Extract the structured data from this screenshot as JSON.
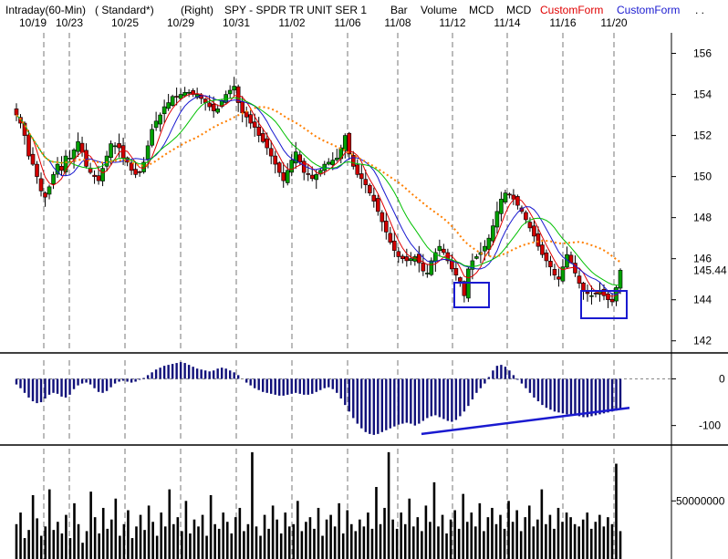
{
  "header": {
    "segments": [
      {
        "text": "Intraday(60-Min)",
        "color": "#000000"
      },
      {
        "text": "( Standard*)",
        "color": "#000000"
      },
      {
        "text": "(Right)",
        "color": "#000000"
      },
      {
        "text": "SPY - SPDR TR UNIT SER 1",
        "color": "#000000"
      },
      {
        "text": "Bar",
        "color": "#000000"
      },
      {
        "text": "Volume",
        "color": "#000000"
      },
      {
        "text": "MCD",
        "color": "#000000"
      },
      {
        "text": "MCD",
        "color": "#000000"
      },
      {
        "text": "CustomForm",
        "color": "#e00000"
      },
      {
        "text": "CustomForm",
        "color": "#1a1ad0"
      },
      {
        "text": ". .",
        "color": "#000000"
      }
    ],
    "dates": [
      "10/19",
      "10/23",
      "10/25",
      "10/29",
      "10/31",
      "11/02",
      "11/06",
      "11/08",
      "11/12",
      "11/14",
      "11/16",
      "11/20"
    ]
  },
  "chart_data": [
    {
      "type": "candlestick",
      "panel": "price",
      "ticker": "SPY - SPDR TR UNIT SER 1",
      "interval": "Intraday(60-Min)",
      "x_dates": [
        "10/19",
        "10/23",
        "10/25",
        "10/29",
        "10/31",
        "11/02",
        "11/06",
        "11/08",
        "11/12",
        "11/14",
        "11/16",
        "11/20"
      ],
      "y_ticks": [
        142,
        144,
        146,
        148,
        150,
        152,
        154,
        156
      ],
      "ylim": [
        141.5,
        157
      ],
      "last_value": "145.44",
      "closes": [
        153.0,
        152.6,
        152.0,
        151.0,
        150.6,
        150.0,
        149.3,
        149.0,
        149.5,
        150.1,
        150.6,
        150.3,
        151.0,
        150.9,
        151.3,
        151.7,
        151.2,
        150.5,
        150.2,
        150.0,
        149.8,
        150.4,
        151.0,
        151.6,
        151.5,
        151.4,
        150.9,
        150.7,
        150.3,
        150.1,
        150.2,
        150.7,
        151.5,
        152.3,
        152.7,
        153.0,
        153.4,
        153.6,
        153.9,
        153.9,
        154.0,
        154.1,
        154.1,
        154.0,
        154.0,
        153.8,
        153.6,
        153.4,
        153.2,
        153.3,
        153.7,
        154.0,
        154.2,
        154.4,
        153.6,
        153.1,
        152.9,
        152.6,
        152.4,
        152.0,
        151.7,
        151.4,
        151.0,
        150.6,
        150.2,
        149.8,
        150.3,
        150.8,
        151.2,
        150.7,
        150.2,
        150.1,
        149.9,
        150.1,
        150.3,
        150.6,
        150.7,
        150.8,
        150.9,
        151.4,
        152.0,
        151.1,
        150.5,
        150.1,
        149.9,
        149.6,
        149.2,
        148.8,
        148.3,
        147.8,
        147.3,
        146.8,
        146.4,
        146.1,
        146.0,
        145.9,
        146.0,
        146.1,
        145.8,
        145.4,
        145.3,
        145.9,
        146.3,
        146.6,
        146.3,
        145.9,
        145.5,
        145.2,
        144.9,
        144.2,
        145.5,
        145.9,
        146.1,
        146.3,
        146.6,
        147.0,
        147.6,
        148.3,
        148.9,
        149.2,
        149.1,
        148.9,
        148.6,
        148.3,
        147.9,
        147.5,
        147.1,
        146.6,
        146.2,
        145.9,
        145.6,
        145.2,
        145.0,
        145.6,
        146.2,
        145.8,
        145.3,
        144.8,
        144.4,
        144.3,
        144.2,
        144.3,
        144.4,
        144.2,
        144.0,
        143.9,
        144.6,
        145.44
      ],
      "moving_averages": [
        {
          "name": "CustomForm",
          "color": "#e00000"
        },
        {
          "name": "CustomForm",
          "color": "#1a1ad0"
        },
        {
          "color": "#00c000"
        },
        {
          "color": "#ff7f00",
          "style": "dotted"
        }
      ],
      "annotations": [
        "blue box around bar near 11/12 low (~144)",
        "blue box around bars near 11/20 low (~144)"
      ]
    },
    {
      "type": "histogram",
      "panel": "MCD",
      "name": "MCD",
      "y_ticks": [
        0,
        -100
      ],
      "ylim": [
        -130,
        40
      ],
      "values": [
        -12,
        -20,
        -30,
        -40,
        -48,
        -52,
        -50,
        -42,
        -34,
        -30,
        -32,
        -38,
        -40,
        -34,
        -22,
        -14,
        -10,
        -8,
        -12,
        -20,
        -28,
        -30,
        -26,
        -18,
        -10,
        -6,
        -4,
        -6,
        -8,
        -6,
        -2,
        2,
        8,
        14,
        20,
        24,
        28,
        30,
        32,
        34,
        36,
        34,
        30,
        26,
        22,
        20,
        18,
        16,
        18,
        22,
        24,
        22,
        18,
        14,
        8,
        0,
        -8,
        -14,
        -20,
        -24,
        -28,
        -30,
        -32,
        -34,
        -36,
        -36,
        -34,
        -32,
        -30,
        -32,
        -34,
        -34,
        -32,
        -28,
        -24,
        -20,
        -18,
        -22,
        -30,
        -42,
        -56,
        -70,
        -84,
        -96,
        -106,
        -114,
        -118,
        -120,
        -118,
        -114,
        -110,
        -106,
        -102,
        -98,
        -96,
        -94,
        -96,
        -100,
        -96,
        -90,
        -84,
        -80,
        -78,
        -82,
        -86,
        -90,
        -92,
        -88,
        -80,
        -70,
        -58,
        -44,
        -30,
        -20,
        -10,
        4,
        18,
        28,
        30,
        26,
        18,
        8,
        -2,
        -10,
        -20,
        -30,
        -40,
        -48,
        -56,
        -62,
        -66,
        -70,
        -72,
        -74,
        -76,
        -78,
        -78,
        -80,
        -82,
        -82,
        -80,
        -78,
        -76,
        -74,
        -72,
        -70,
        -68,
        -66
      ],
      "trendline": {
        "from_value": -118,
        "to_value": -66,
        "color": "#1a1ad0"
      }
    },
    {
      "type": "bar",
      "panel": "Volume",
      "name": "Volume",
      "y_ticks": [
        50000000
      ],
      "y_tick_labels": [
        "50000000"
      ],
      "ylim": [
        0,
        95000000
      ],
      "values": [
        30,
        40,
        18,
        25,
        55,
        35,
        20,
        28,
        60,
        25,
        32,
        22,
        38,
        18,
        48,
        30,
        14,
        24,
        58,
        36,
        22,
        44,
        26,
        34,
        52,
        20,
        30,
        42,
        18,
        28,
        38,
        25,
        46,
        32,
        20,
        40,
        28,
        60,
        30,
        36,
        24,
        50,
        22,
        34,
        28,
        38,
        20,
        55,
        30,
        26,
        40,
        32,
        22,
        36,
        44,
        24,
        30,
        92,
        28,
        20,
        38,
        26,
        46,
        34,
        22,
        40,
        28,
        30,
        50,
        24,
        32,
        36,
        26,
        44,
        20,
        34,
        38,
        28,
        48,
        22,
        42,
        30,
        24,
        34,
        28,
        40,
        26,
        62,
        30,
        44,
        92,
        34,
        26,
        40,
        30,
        52,
        28,
        36,
        24,
        46,
        32,
        66,
        28,
        38,
        22,
        34,
        42,
        26,
        56,
        32,
        40,
        28,
        48,
        24,
        36,
        44,
        30,
        38,
        26,
        50,
        32,
        42,
        24,
        36,
        46,
        28,
        34,
        60,
        30,
        38,
        26,
        44,
        32,
        40,
        36,
        30,
        28,
        34,
        40,
        26,
        32,
        38,
        28,
        36,
        30,
        82,
        24
      ],
      "unit_scale": 1000000
    }
  ]
}
